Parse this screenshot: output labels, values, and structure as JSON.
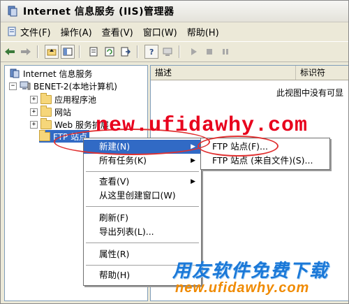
{
  "window": {
    "title": "Internet 信息服务 (IIS)管理器"
  },
  "menubar": {
    "items": [
      {
        "label": "文件(F)",
        "icon": "file-icon"
      },
      {
        "label": "操作(A)",
        "icon": ""
      },
      {
        "label": "查看(V)",
        "icon": ""
      },
      {
        "label": "窗口(W)",
        "icon": ""
      },
      {
        "label": "帮助(H)",
        "icon": ""
      }
    ]
  },
  "toolbar": {
    "buttons": [
      "back-icon",
      "forward-icon",
      "up-icon",
      "show-tree-icon",
      "properties-icon",
      "refresh-icon",
      "export-icon",
      "help-icon",
      "computer-icon",
      "play-icon",
      "stop-icon",
      "pause-icon"
    ]
  },
  "tree": {
    "root": "Internet 信息服务",
    "server": "BENET-2(本地计算机)",
    "nodes": [
      "应用程序池",
      "网站",
      "Web 服务扩展",
      "FTP 站点"
    ]
  },
  "list": {
    "columns": [
      "描述",
      "标识符"
    ],
    "empty_message": "此视图中没有可显"
  },
  "context_menu": {
    "items": [
      {
        "label": "新建(N)",
        "submenu": true
      },
      {
        "label": "所有任务(K)",
        "submenu": true
      },
      {
        "label": "查看(V)",
        "submenu": true
      },
      {
        "label": "从这里创建窗口(W)",
        "submenu": false
      },
      {
        "label": "刷新(F)",
        "submenu": false
      },
      {
        "label": "导出列表(L)...",
        "submenu": false
      },
      {
        "label": "属性(R)",
        "submenu": false
      },
      {
        "label": "帮助(H)",
        "submenu": false
      }
    ]
  },
  "submenu": {
    "items": [
      {
        "label": "FTP 站点(F)..."
      },
      {
        "label": "FTP 站点 (来自文件)(S)..."
      }
    ]
  },
  "watermarks": {
    "url_top": "new.ufidawhy.com",
    "banner": "用友软件免费下载",
    "url_bottom": "new.ufidawhy.com"
  },
  "colors": {
    "highlight": "#316ac5",
    "watermark_red": "#e8001c",
    "watermark_blue": "#1a78d8",
    "annotation_red": "#e03030"
  }
}
